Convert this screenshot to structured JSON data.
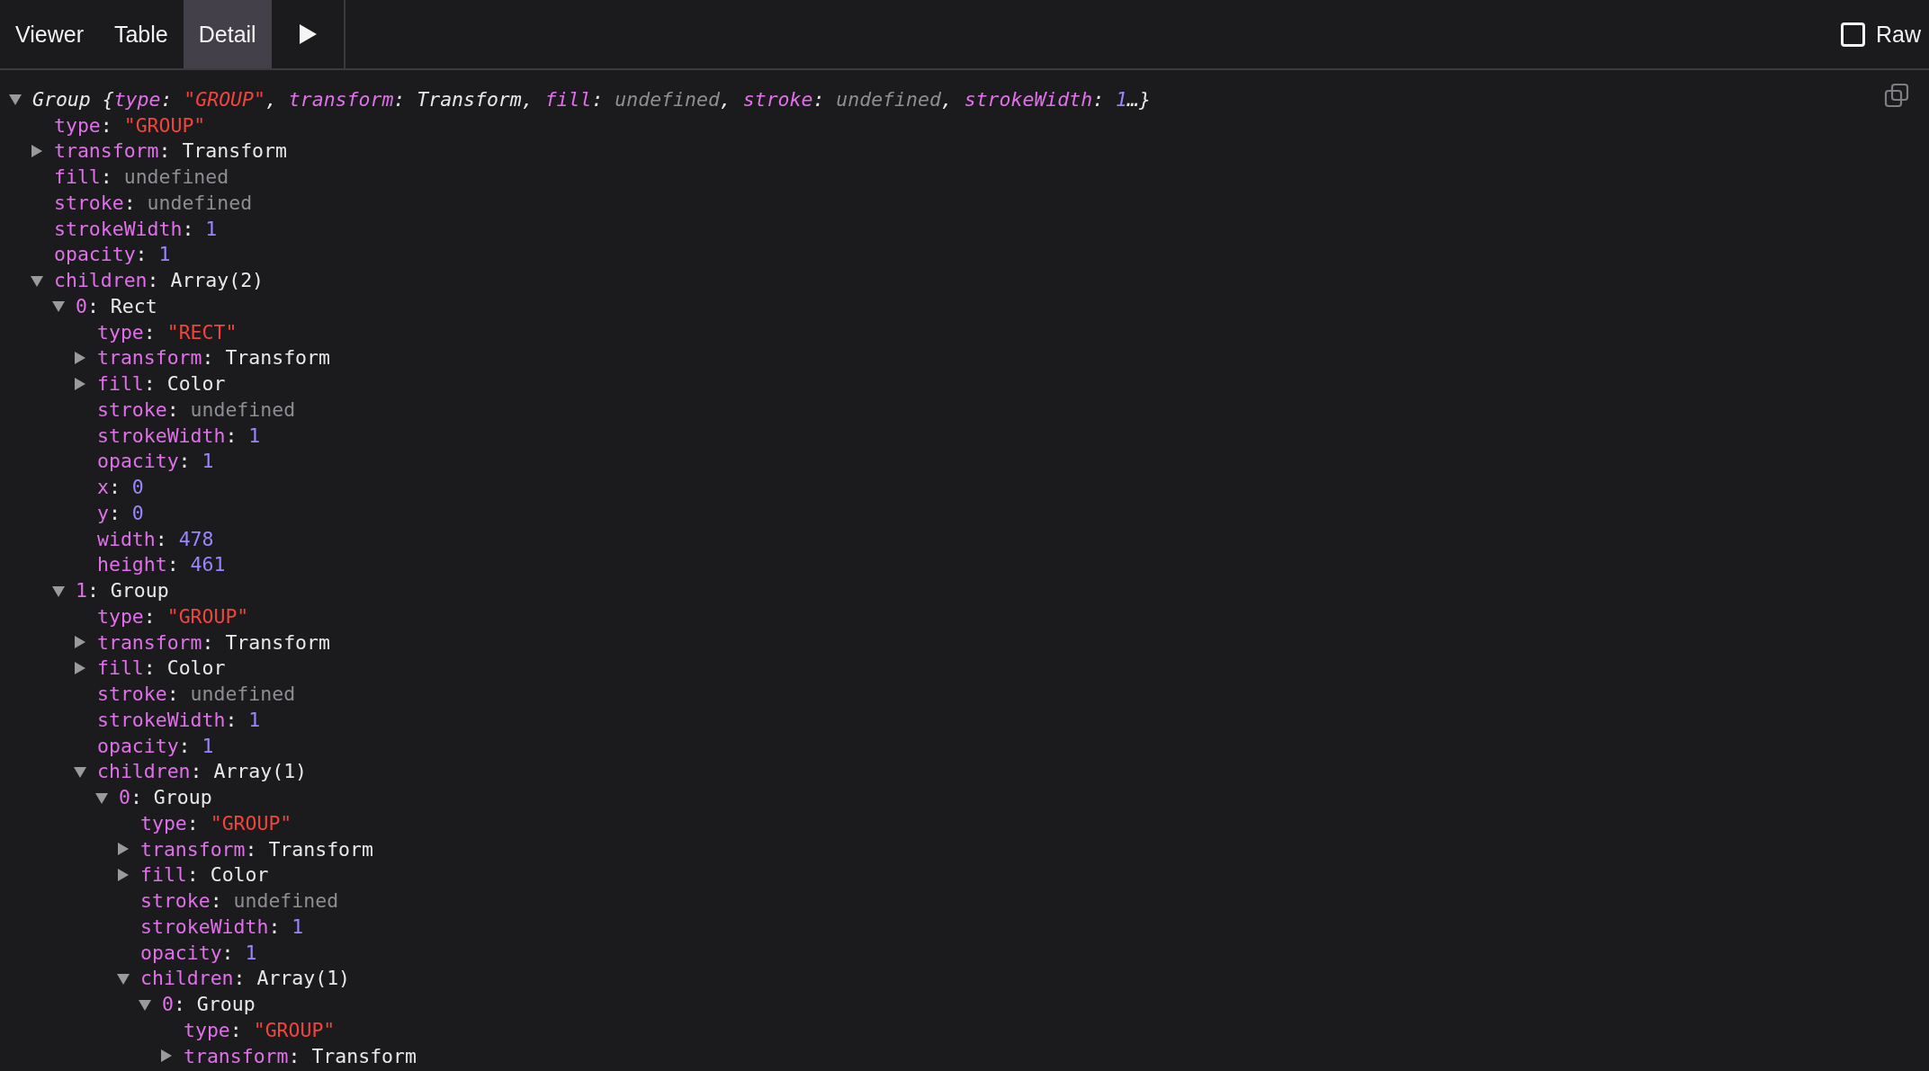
{
  "tabs": [
    {
      "label": "Viewer",
      "selected": false
    },
    {
      "label": "Table",
      "selected": false
    },
    {
      "label": "Detail",
      "selected": true
    }
  ],
  "raw_toggle": {
    "label": "Raw",
    "checked": false
  },
  "punctuation": {
    "colon": ":",
    "comma": ","
  },
  "tree": {
    "label": "Group",
    "expanded": true,
    "open": "{",
    "close": "…}",
    "preview": [
      {
        "key": "type",
        "value": "\"GROUP\"",
        "kind": "string"
      },
      {
        "key": "transform",
        "value": "Transform",
        "kind": "object"
      },
      {
        "key": "fill",
        "value": "undefined",
        "kind": "undefined"
      },
      {
        "key": "stroke",
        "value": "undefined",
        "kind": "undefined"
      },
      {
        "key": "strokeWidth",
        "value": "1",
        "kind": "number"
      }
    ],
    "children": [
      {
        "key": "type",
        "value": "\"GROUP\"",
        "kind": "string"
      },
      {
        "key": "transform",
        "value": "Transform",
        "kind": "object",
        "expanded": false
      },
      {
        "key": "fill",
        "value": "undefined",
        "kind": "undefined"
      },
      {
        "key": "stroke",
        "value": "undefined",
        "kind": "undefined"
      },
      {
        "key": "strokeWidth",
        "value": "1",
        "kind": "number"
      },
      {
        "key": "opacity",
        "value": "1",
        "kind": "number"
      },
      {
        "key": "children",
        "value": "Array(2)",
        "kind": "object",
        "expanded": true,
        "children": [
          {
            "key": "0",
            "value": "Rect",
            "kind": "object",
            "expanded": true,
            "children": [
              {
                "key": "type",
                "value": "\"RECT\"",
                "kind": "string"
              },
              {
                "key": "transform",
                "value": "Transform",
                "kind": "object",
                "expanded": false
              },
              {
                "key": "fill",
                "value": "Color",
                "kind": "object",
                "expanded": false
              },
              {
                "key": "stroke",
                "value": "undefined",
                "kind": "undefined"
              },
              {
                "key": "strokeWidth",
                "value": "1",
                "kind": "number"
              },
              {
                "key": "opacity",
                "value": "1",
                "kind": "number"
              },
              {
                "key": "x",
                "value": "0",
                "kind": "number"
              },
              {
                "key": "y",
                "value": "0",
                "kind": "number"
              },
              {
                "key": "width",
                "value": "478",
                "kind": "number"
              },
              {
                "key": "height",
                "value": "461",
                "kind": "number"
              }
            ]
          },
          {
            "key": "1",
            "value": "Group",
            "kind": "object",
            "expanded": true,
            "children": [
              {
                "key": "type",
                "value": "\"GROUP\"",
                "kind": "string"
              },
              {
                "key": "transform",
                "value": "Transform",
                "kind": "object",
                "expanded": false
              },
              {
                "key": "fill",
                "value": "Color",
                "kind": "object",
                "expanded": false
              },
              {
                "key": "stroke",
                "value": "undefined",
                "kind": "undefined"
              },
              {
                "key": "strokeWidth",
                "value": "1",
                "kind": "number"
              },
              {
                "key": "opacity",
                "value": "1",
                "kind": "number"
              },
              {
                "key": "children",
                "value": "Array(1)",
                "kind": "object",
                "expanded": true,
                "children": [
                  {
                    "key": "0",
                    "value": "Group",
                    "kind": "object",
                    "expanded": true,
                    "children": [
                      {
                        "key": "type",
                        "value": "\"GROUP\"",
                        "kind": "string"
                      },
                      {
                        "key": "transform",
                        "value": "Transform",
                        "kind": "object",
                        "expanded": false
                      },
                      {
                        "key": "fill",
                        "value": "Color",
                        "kind": "object",
                        "expanded": false
                      },
                      {
                        "key": "stroke",
                        "value": "undefined",
                        "kind": "undefined"
                      },
                      {
                        "key": "strokeWidth",
                        "value": "1",
                        "kind": "number"
                      },
                      {
                        "key": "opacity",
                        "value": "1",
                        "kind": "number"
                      },
                      {
                        "key": "children",
                        "value": "Array(1)",
                        "kind": "object",
                        "expanded": true,
                        "children": [
                          {
                            "key": "0",
                            "value": "Group",
                            "kind": "object",
                            "expanded": true,
                            "children": [
                              {
                                "key": "type",
                                "value": "\"GROUP\"",
                                "kind": "string"
                              },
                              {
                                "key": "transform",
                                "value": "Transform",
                                "kind": "object",
                                "expanded": false
                              }
                            ]
                          }
                        ]
                      }
                    ]
                  }
                ]
              }
            ]
          }
        ]
      }
    ]
  }
}
